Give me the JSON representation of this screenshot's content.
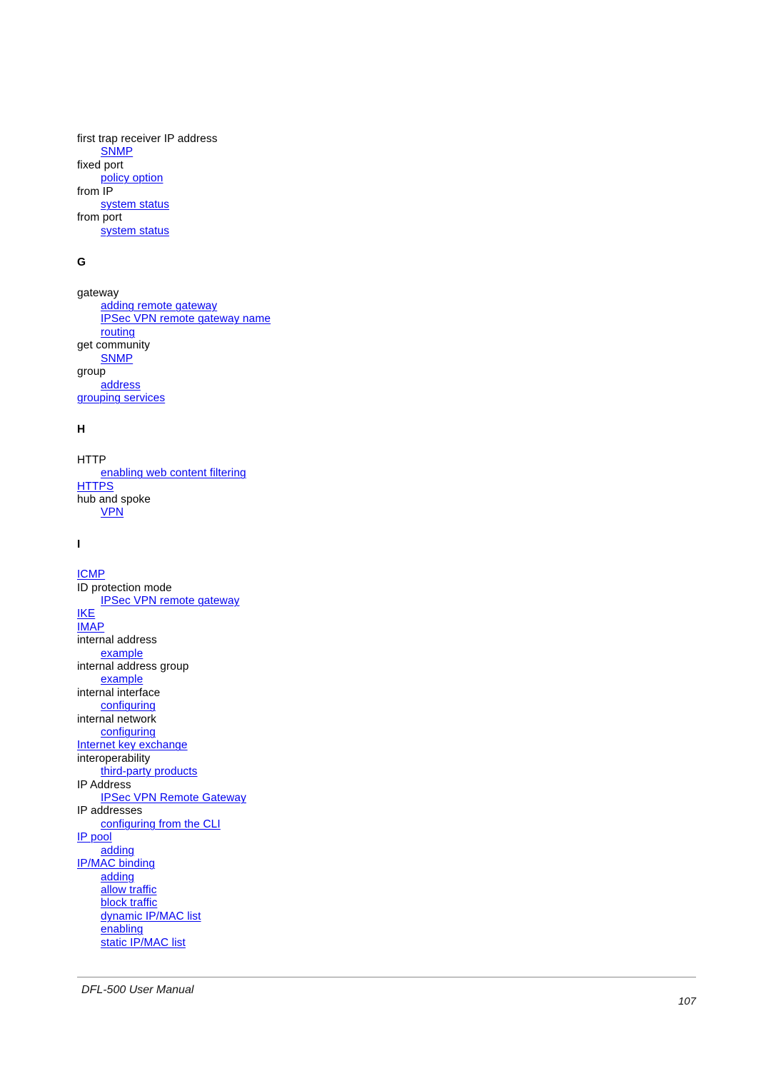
{
  "document": {
    "footer_title": "DFL-500 User Manual",
    "page_number": "107",
    "link_color": "#0000ee",
    "text_color": "#000000",
    "rule_color": "#8a8a8a"
  },
  "index": {
    "blocks": [
      {
        "type": "entries",
        "rows": [
          {
            "level": "main",
            "text": "first trap receiver IP address",
            "link": false
          },
          {
            "level": "sub",
            "text": "SNMP",
            "link": true
          },
          {
            "level": "main",
            "text": "fixed port",
            "link": false
          },
          {
            "level": "sub",
            "text": "policy option",
            "link": true
          },
          {
            "level": "main",
            "text": "from IP",
            "link": false
          },
          {
            "level": "sub",
            "text": "system status",
            "link": true
          },
          {
            "level": "main",
            "text": "from port",
            "link": false
          },
          {
            "level": "sub",
            "text": "system status",
            "link": true
          }
        ]
      },
      {
        "type": "section",
        "letter": "G",
        "rows": [
          {
            "level": "main",
            "text": "gateway",
            "link": false
          },
          {
            "level": "sub",
            "text": "adding remote gateway",
            "link": true
          },
          {
            "level": "sub",
            "text": "IPSec VPN remote gateway name",
            "link": true
          },
          {
            "level": "sub",
            "text": "routing",
            "link": true
          },
          {
            "level": "main",
            "text": "get community",
            "link": false
          },
          {
            "level": "sub",
            "text": "SNMP",
            "link": true
          },
          {
            "level": "main",
            "text": "group",
            "link": false
          },
          {
            "level": "sub",
            "text": "address",
            "link": true
          },
          {
            "level": "main",
            "text": "grouping services",
            "link": true
          }
        ]
      },
      {
        "type": "section",
        "letter": "H",
        "rows": [
          {
            "level": "main",
            "text": "HTTP",
            "link": false
          },
          {
            "level": "sub",
            "text": "enabling web content filtering",
            "link": true
          },
          {
            "level": "main",
            "text": "HTTPS",
            "link": true
          },
          {
            "level": "main",
            "text": "hub and spoke",
            "link": false
          },
          {
            "level": "sub",
            "text": "VPN",
            "link": true
          }
        ]
      },
      {
        "type": "section",
        "letter": "I",
        "rows": [
          {
            "level": "main",
            "text": "ICMP",
            "link": true
          },
          {
            "level": "main",
            "text": "ID protection mode",
            "link": false
          },
          {
            "level": "sub",
            "text": "IPSec VPN remote gateway",
            "link": true
          },
          {
            "level": "main",
            "text": "IKE",
            "link": true
          },
          {
            "level": "main",
            "text": "IMAP",
            "link": true
          },
          {
            "level": "main",
            "text": "internal address",
            "link": false
          },
          {
            "level": "sub",
            "text": "example",
            "link": true
          },
          {
            "level": "main",
            "text": "internal address group",
            "link": false
          },
          {
            "level": "sub",
            "text": "example",
            "link": true
          },
          {
            "level": "main",
            "text": "internal interface",
            "link": false
          },
          {
            "level": "sub",
            "text": "configuring",
            "link": true
          },
          {
            "level": "main",
            "text": "internal network",
            "link": false
          },
          {
            "level": "sub",
            "text": "configuring",
            "link": true
          },
          {
            "level": "main",
            "text": "Internet key exchange",
            "link": true
          },
          {
            "level": "main",
            "text": "interoperability",
            "link": false
          },
          {
            "level": "sub",
            "text": "third-party products",
            "link": true
          },
          {
            "level": "main",
            "text": "IP Address",
            "link": false
          },
          {
            "level": "sub",
            "text": "IPSec VPN Remote Gateway",
            "link": true
          },
          {
            "level": "main",
            "text": "IP addresses",
            "link": false
          },
          {
            "level": "sub",
            "text": "configuring from the CLI",
            "link": true
          },
          {
            "level": "main",
            "text": "IP pool",
            "link": true
          },
          {
            "level": "sub",
            "text": "adding",
            "link": true
          },
          {
            "level": "main",
            "text": "IP/MAC binding",
            "link": true
          },
          {
            "level": "sub",
            "text": "adding",
            "link": true
          },
          {
            "level": "sub",
            "text": "allow traffic",
            "link": true
          },
          {
            "level": "sub",
            "text": "block traffic",
            "link": true
          },
          {
            "level": "sub",
            "text": "dynamic IP/MAC list",
            "link": true
          },
          {
            "level": "sub",
            "text": "enabling",
            "link": true
          },
          {
            "level": "sub",
            "text": "static IP/MAC list",
            "link": true
          }
        ]
      }
    ]
  }
}
